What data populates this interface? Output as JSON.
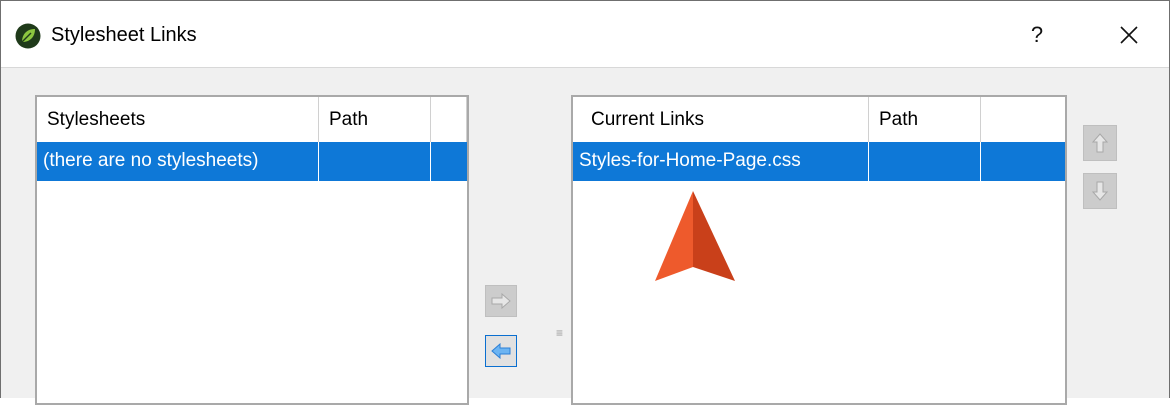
{
  "window": {
    "title": "Stylesheet Links",
    "help_label": "?",
    "icon": "leaf-app-icon",
    "close_icon": "close-icon"
  },
  "stylesheets": {
    "columns": [
      "Stylesheets",
      "Path"
    ],
    "rows": [
      {
        "name": "(there are no stylesheets)",
        "path": "",
        "selected": true
      }
    ]
  },
  "current_links": {
    "columns": [
      "Current Links",
      "Path"
    ],
    "rows": [
      {
        "name": "Styles-for-Home-Page.css",
        "path": "",
        "selected": true
      }
    ]
  },
  "buttons": {
    "add_link": {
      "icon": "arrow-right-icon",
      "enabled": false
    },
    "remove_link": {
      "icon": "arrow-left-icon",
      "enabled": true
    },
    "move_up": {
      "icon": "arrow-up-icon",
      "enabled": false
    },
    "move_down": {
      "icon": "arrow-down-icon",
      "enabled": false
    }
  },
  "annotation": {
    "icon": "pointer-arrow-icon",
    "color": "#e8542a"
  },
  "colors": {
    "selection": "#0e78d7",
    "accent_arrow": "#3a8ee6"
  }
}
